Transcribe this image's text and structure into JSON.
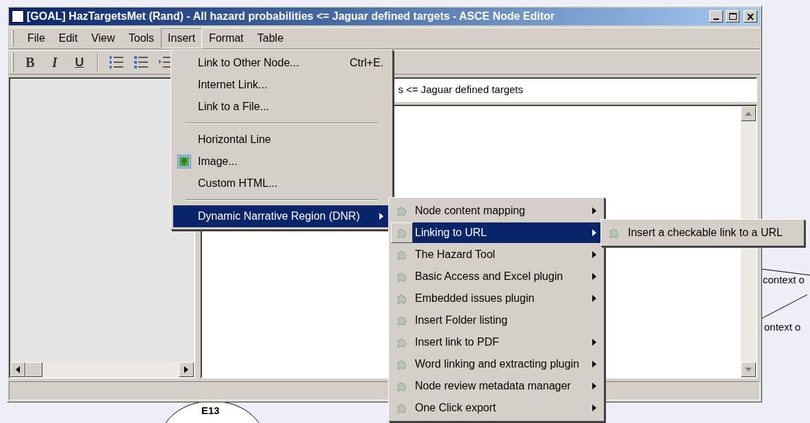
{
  "window": {
    "title": "[GOAL] HazTargetsMet (Rand) - All hazard probabilities <= Jaguar defined targets - ASCE Node Editor"
  },
  "menu_bar": [
    {
      "label": "File",
      "selected": false
    },
    {
      "label": "Edit",
      "selected": false
    },
    {
      "label": "View",
      "selected": false
    },
    {
      "label": "Tools",
      "selected": false
    },
    {
      "label": "Insert",
      "selected": true
    },
    {
      "label": "Format",
      "selected": false
    },
    {
      "label": "Table",
      "selected": false
    }
  ],
  "toolbar": [
    {
      "kind": "bold",
      "label": "B"
    },
    {
      "kind": "italic",
      "label": "I"
    },
    {
      "kind": "underline",
      "label": "U"
    },
    {
      "kind": "separator"
    },
    {
      "kind": "numbered-list"
    },
    {
      "kind": "bulleted-list"
    },
    {
      "kind": "indent"
    }
  ],
  "title_field": {
    "value": "s <= Jaguar defined targets"
  },
  "insert_menu": [
    {
      "kind": "item",
      "label": "Link to Other Node...",
      "shortcut": "Ctrl+E.",
      "icon": false,
      "submenu": false,
      "selected": false
    },
    {
      "kind": "item",
      "label": "Internet Link...",
      "icon": false,
      "submenu": false,
      "selected": false
    },
    {
      "kind": "item",
      "label": "Link to a File...",
      "icon": false,
      "submenu": false,
      "selected": false
    },
    {
      "kind": "separator"
    },
    {
      "kind": "item",
      "label": "Horizontal Line",
      "icon": false,
      "submenu": false,
      "selected": false
    },
    {
      "kind": "item",
      "label": "Image...",
      "icon": true,
      "submenu": false,
      "selected": false
    },
    {
      "kind": "item",
      "label": "Custom HTML...",
      "icon": false,
      "submenu": false,
      "selected": false
    },
    {
      "kind": "separator"
    },
    {
      "kind": "item",
      "label": "Dynamic Narrative Region (DNR)",
      "icon": false,
      "submenu": true,
      "selected": true
    }
  ],
  "dnr_menu": [
    {
      "label": "Node content mapping",
      "submenu": true,
      "selected": false
    },
    {
      "label": "Linking to URL",
      "submenu": true,
      "selected": true
    },
    {
      "label": "The Hazard Tool",
      "submenu": true,
      "selected": false
    },
    {
      "label": "Basic Access and Excel plugin",
      "submenu": true,
      "selected": false
    },
    {
      "label": "Embedded issues plugin",
      "submenu": true,
      "selected": false
    },
    {
      "label": "Insert Folder listing",
      "submenu": false,
      "selected": false
    },
    {
      "label": "Insert link to PDF",
      "submenu": true,
      "selected": false
    },
    {
      "label": "Word linking and extracting plugin",
      "submenu": true,
      "selected": false
    },
    {
      "label": "Node review metadata manager",
      "submenu": true,
      "selected": false
    },
    {
      "label": "One Click export",
      "submenu": true,
      "selected": false
    }
  ],
  "url_menu": [
    {
      "label": "Insert a checkable link to a URL"
    }
  ],
  "diagram": {
    "node_label": "E13",
    "edge_labels": [
      "context o",
      "ontext o"
    ]
  }
}
